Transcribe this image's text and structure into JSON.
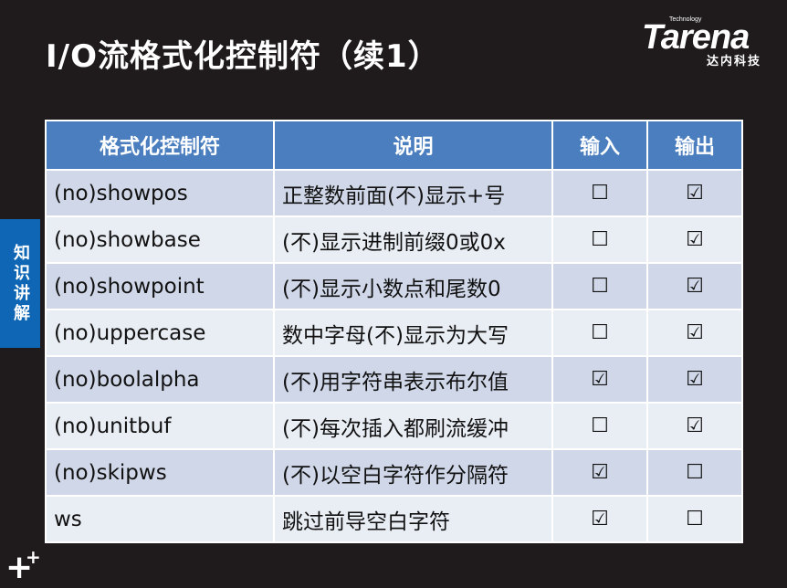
{
  "title": "I/O流格式化控制符（续1）",
  "logo": {
    "tech": "Technology",
    "word": "Tarena",
    "sub": "达内科技"
  },
  "side_tab": "知识讲解",
  "table": {
    "headers": [
      "格式化控制符",
      "说明",
      "输入",
      "输出"
    ],
    "rows": [
      {
        "name": "(no)showpos",
        "desc": "正整数前面(不)显示+号",
        "in": "☐",
        "out": "☑"
      },
      {
        "name": "(no)showbase",
        "desc": "(不)显示进制前缀0或0x",
        "in": "☐",
        "out": "☑"
      },
      {
        "name": "(no)showpoint",
        "desc": "(不)显示小数点和尾数0",
        "in": "☐",
        "out": "☑"
      },
      {
        "name": "(no)uppercase",
        "desc": "数中字母(不)显示为大写",
        "in": "☐",
        "out": "☑"
      },
      {
        "name": "(no)boolalpha",
        "desc": "(不)用字符串表示布尔值",
        "in": "☑",
        "out": "☑"
      },
      {
        "name": "(no)unitbuf",
        "desc": "(不)每次插入都刷流缓冲",
        "in": "☐",
        "out": "☑"
      },
      {
        "name": "(no)skipws",
        "desc": "(不)以空白字符作分隔符",
        "in": "☑",
        "out": "☐"
      },
      {
        "name": "ws",
        "desc": "跳过前导空白字符",
        "in": "☑",
        "out": "☐"
      }
    ]
  },
  "colors": {
    "background": "#1f1b1c",
    "header": "#4a7ebf",
    "row_odd": "#cfd7e8",
    "row_even": "#e9edf4",
    "side_tab": "#0e66b4"
  },
  "decoration": {
    "plus_big": "+",
    "plus_small": "+"
  }
}
